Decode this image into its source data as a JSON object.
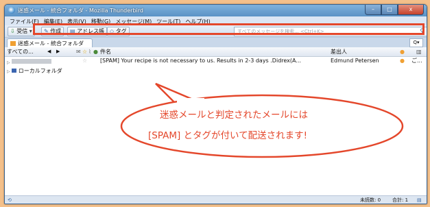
{
  "window": {
    "title": "迷惑メール - 統合フォルダ - Mozilla Thunderbird",
    "min_label": "–",
    "max_label": "□",
    "close_label": "x"
  },
  "menu": [
    "ファイル(F)",
    "編集(E)",
    "表示(V)",
    "移動(G)",
    "メッセージ(M)",
    "ツール(T)",
    "ヘルプ(H)"
  ],
  "toolbar": {
    "receive": "受信",
    "compose": "作成",
    "addressbook": "アドレス帳",
    "tag": "タグ",
    "search_placeholder": "すべてのメッセージを検索... <Ctrl+K>"
  },
  "tab": {
    "label": "迷惑メール - 統合フォルダ",
    "menu_label": "Q▾"
  },
  "folder_pane": {
    "view_label": "すべての...",
    "folders": [
      {
        "label": ""
      },
      {
        "label": "ローカルフォルダ"
      }
    ]
  },
  "thread_pane": {
    "columns": {
      "subject": "件名",
      "sender": "差出人"
    },
    "message": {
      "subject": "[SPAM]  Your recipe is not necessary to us. Results in 2-3 days .Didrex(A...",
      "sender": "Edmund Petersen",
      "extra": "ご..."
    }
  },
  "status": {
    "unread_label": "未読数: 0",
    "total_label": "合計: 1"
  },
  "callout": {
    "line1": "迷惑メールと判定されたメールには",
    "line2": "[SPAM] とタグが付いて配送されます!"
  },
  "colors": {
    "accent": "#e4472b",
    "background": "#f4c08a"
  }
}
